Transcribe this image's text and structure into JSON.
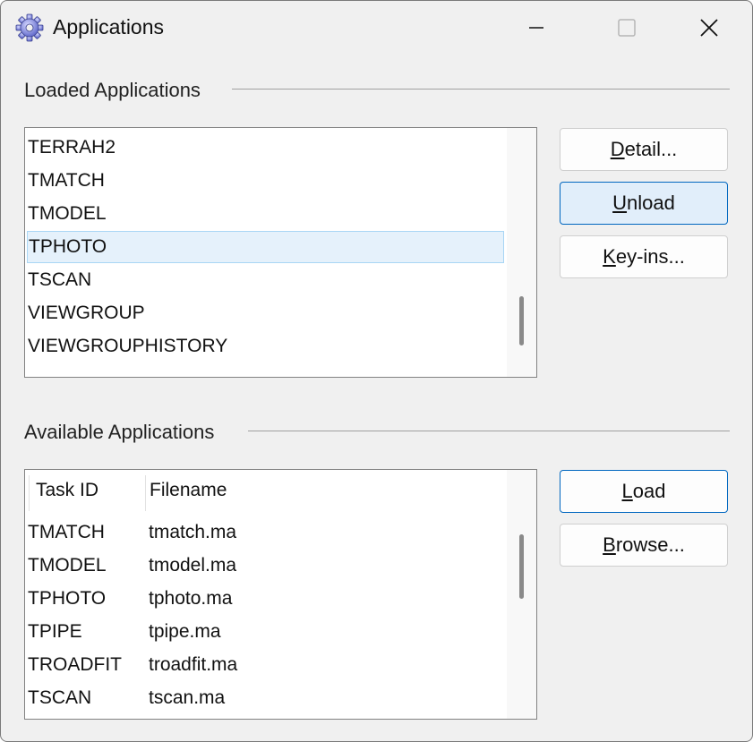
{
  "window": {
    "title": "Applications",
    "icon": "gear-icon"
  },
  "loaded": {
    "section_label": "Loaded Applications",
    "items": [
      {
        "label": "TERRAH2",
        "selected": false
      },
      {
        "label": "TMATCH",
        "selected": false
      },
      {
        "label": "TMODEL",
        "selected": false
      },
      {
        "label": "TPHOTO",
        "selected": true
      },
      {
        "label": "TSCAN",
        "selected": false
      },
      {
        "label": "VIEWGROUP",
        "selected": false
      },
      {
        "label": "VIEWGROUPHISTORY",
        "selected": false
      }
    ],
    "buttons": {
      "detail": {
        "pre": "",
        "mn": "D",
        "post": "etail..."
      },
      "unload": {
        "pre": "",
        "mn": "U",
        "post": "nload"
      },
      "keyins": {
        "pre": "",
        "mn": "K",
        "post": "ey-ins..."
      }
    }
  },
  "available": {
    "section_label": "Available Applications",
    "columns": [
      "Task ID",
      "Filename"
    ],
    "rows": [
      {
        "task_id": "TMATCH",
        "filename": "tmatch.ma"
      },
      {
        "task_id": "TMODEL",
        "filename": "tmodel.ma"
      },
      {
        "task_id": "TPHOTO",
        "filename": "tphoto.ma"
      },
      {
        "task_id": "TPIPE",
        "filename": "tpipe.ma"
      },
      {
        "task_id": "TROADFIT",
        "filename": "troadfit.ma"
      },
      {
        "task_id": "TSCAN",
        "filename": "tscan.ma"
      }
    ],
    "buttons": {
      "load": {
        "pre": "",
        "mn": "L",
        "post": "oad"
      },
      "browse": {
        "pre": "",
        "mn": "B",
        "post": "rowse..."
      }
    }
  },
  "colors": {
    "selection_bg": "#e5f1fb",
    "selection_border": "#a9d6f5",
    "accent": "#0067c0"
  }
}
